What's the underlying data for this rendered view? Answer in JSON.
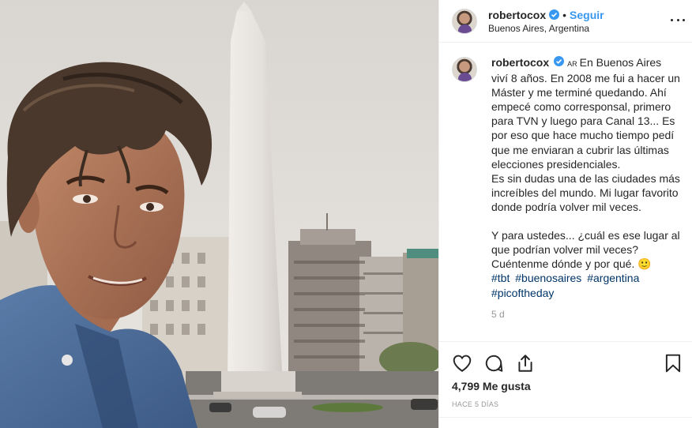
{
  "header": {
    "username": "robertocox",
    "follow_label": "Seguir",
    "separator": "•",
    "location": "Buenos Aires, Argentina"
  },
  "caption": {
    "username": "robertocox",
    "country_code": "AR",
    "text": "En Buenos Aires viví 8 años. En 2008 me fui a hacer un Máster y me terminé quedando. Ahí empecé como corresponsal, primero para TVN y luego para Canal 13... Es por eso que hace mucho tiempo pedí que me enviaran a cubrir las últimas elecciones presidenciales.\nEs sin dudas una de las ciudades más increíbles del mundo. Mi lugar favorito donde podría volver mil veces.\n\nY para ustedes... ¿cuál es ese lugar al que podrían volver mil veces? Cuéntenme dónde y por qué. 🙂",
    "hashtags": [
      "#tbt",
      "#buenosaires",
      "#argentina",
      "#picoftheday"
    ],
    "age": "5 d"
  },
  "actions": {
    "icons": [
      "heart-icon",
      "comment-icon",
      "share-icon",
      "bookmark-icon"
    ]
  },
  "likes": "4,799 Me gusta",
  "time_ago": "HACE 5 DÍAS",
  "colors": {
    "link_blue": "#3897f0",
    "hashtag_blue": "#003569",
    "border": "#efefef",
    "muted": "#999999"
  }
}
